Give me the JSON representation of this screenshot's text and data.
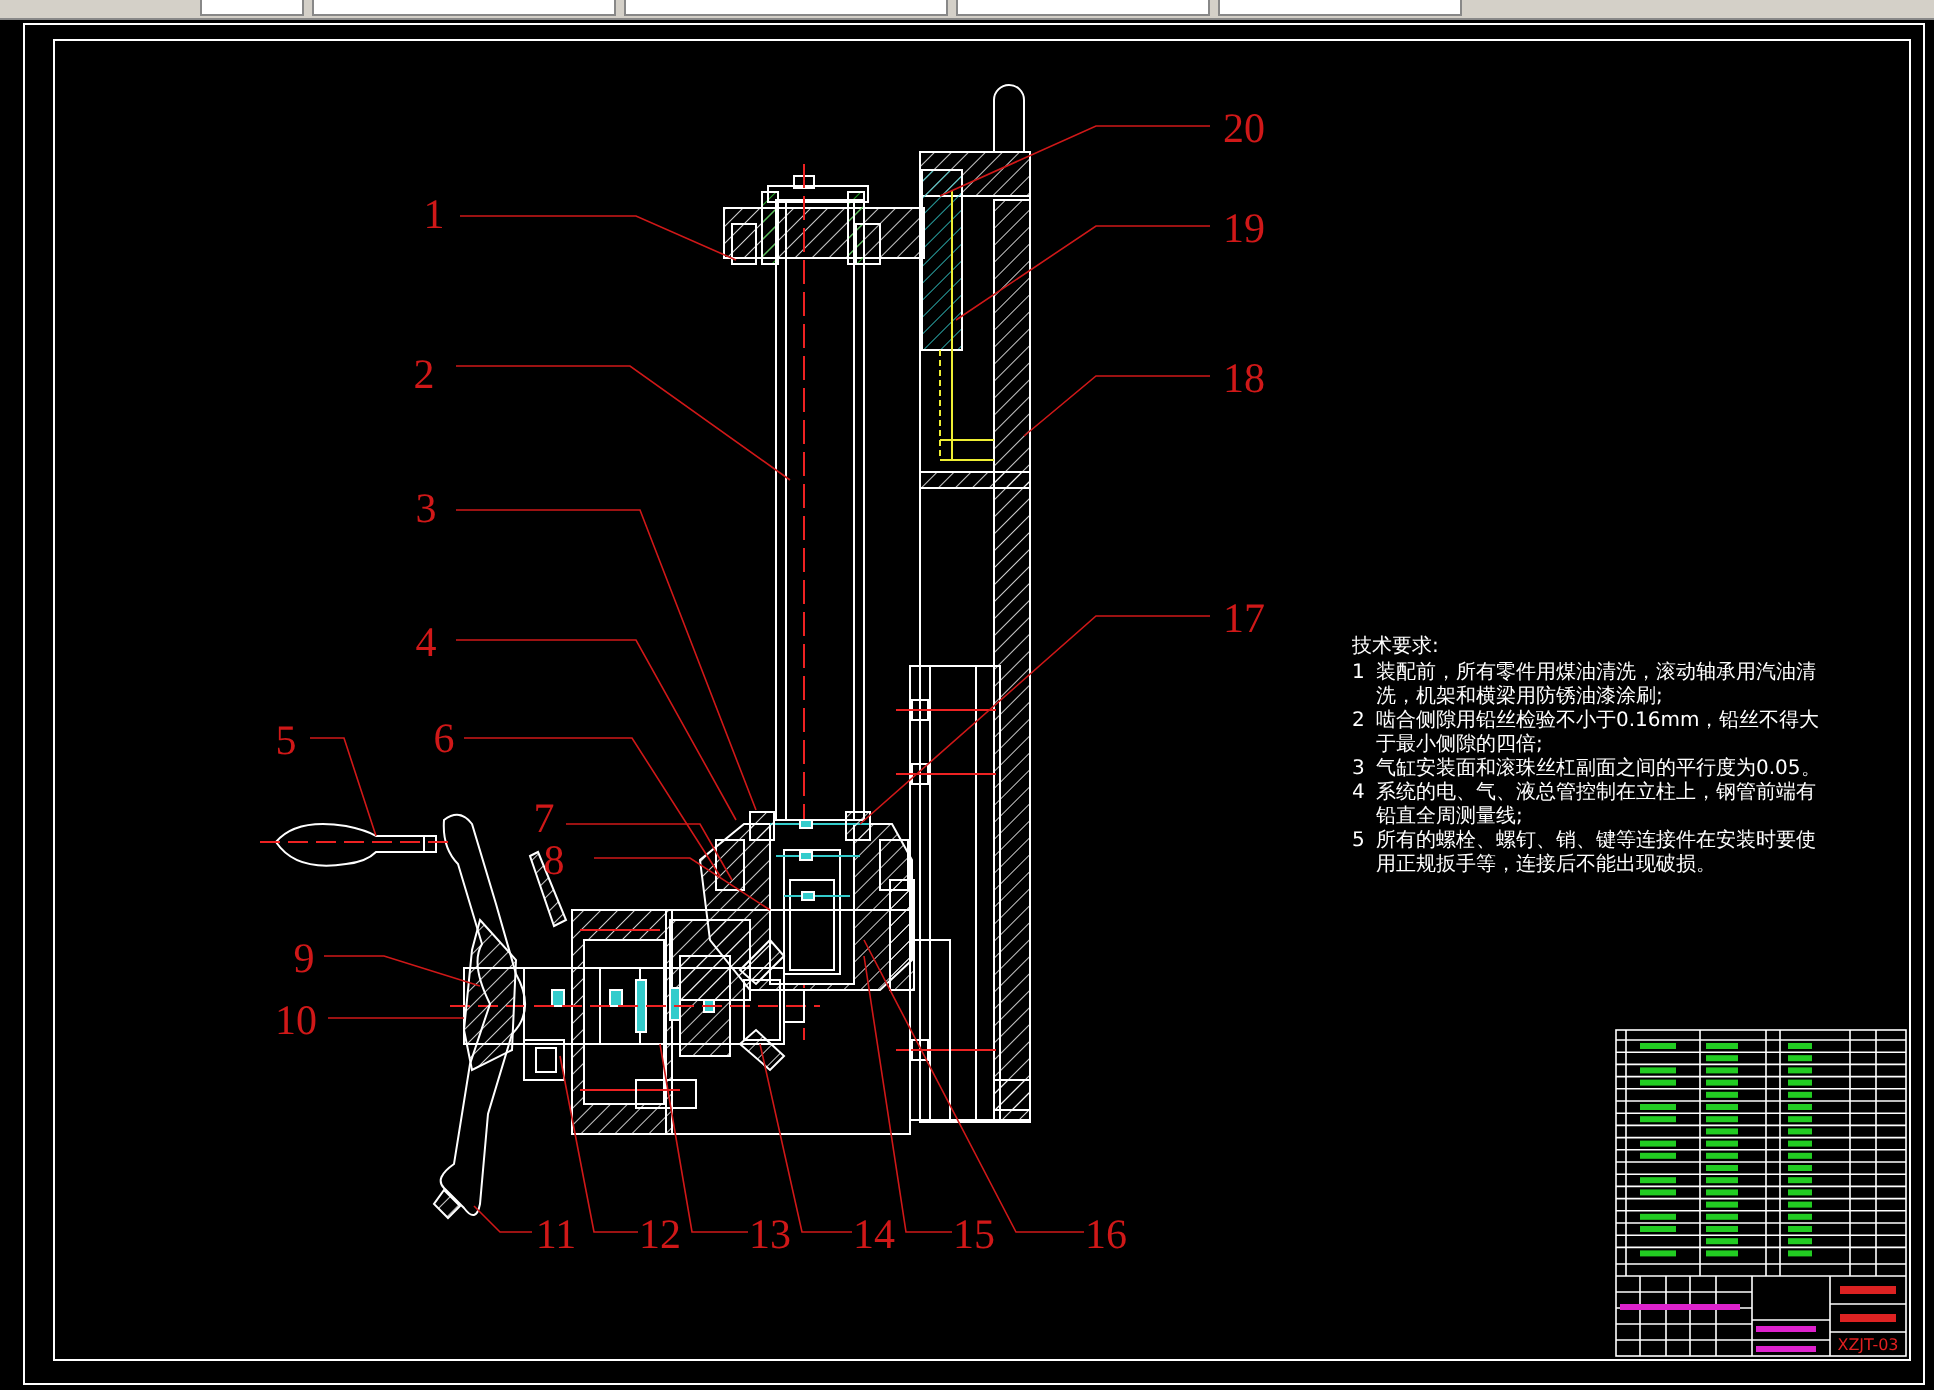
{
  "drawing": {
    "left_callouts": [
      {
        "label": "1"
      },
      {
        "label": "2"
      },
      {
        "label": "3"
      },
      {
        "label": "4"
      },
      {
        "label": "5"
      },
      {
        "label": "6"
      },
      {
        "label": "7"
      },
      {
        "label": "8"
      },
      {
        "label": "9"
      },
      {
        "label": "10"
      },
      {
        "label": "11"
      },
      {
        "label": "12"
      },
      {
        "label": "13"
      },
      {
        "label": "14"
      },
      {
        "label": "15"
      },
      {
        "label": "16"
      }
    ],
    "right_callouts": [
      {
        "label": "20"
      },
      {
        "label": "19"
      },
      {
        "label": "18"
      },
      {
        "label": "17"
      }
    ]
  },
  "technical_requirements": {
    "title": "技术要求:",
    "items": [
      {
        "number": "1",
        "text": "装配前，所有零件用煤油清洗，滚动轴承用汽油清洗，机架和横梁用防锈油漆涂刷;"
      },
      {
        "number": "2",
        "text": "啮合侧隙用铅丝检验不小于0.16mm，铅丝不得大于最小侧隙的四倍;"
      },
      {
        "number": "3",
        "text": "气缸安装面和滚珠丝杠副面之间的平行度为0.05。"
      },
      {
        "number": "4",
        "text": "系统的电、气、液总管控制在立柱上，钢管前端有铅直全周测量线;"
      },
      {
        "number": "5",
        "text": "所有的螺栓、螺钉、销、键等连接件在安装时要使用正规扳手等，连接后不能出现破损。"
      }
    ]
  },
  "title_block": {
    "drawing_number": "XZJT-03"
  }
}
